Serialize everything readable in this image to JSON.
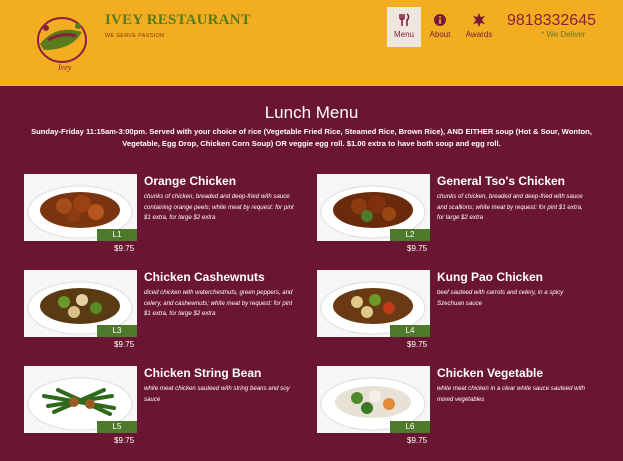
{
  "header": {
    "brand": "IVEY RESTAURANT",
    "tagline": "WE SERVE PASSION",
    "logo_text": "Ivey",
    "phone": "9818332645",
    "deliver": "* We Deliver",
    "nav": [
      {
        "label": "Menu",
        "icon": "restaurant-icon",
        "active": true
      },
      {
        "label": "About",
        "icon": "info-icon",
        "active": false
      },
      {
        "label": "Awards",
        "icon": "award-icon",
        "active": false
      }
    ]
  },
  "main": {
    "title": "Lunch Menu",
    "description": "Sunday-Friday 11:15am-3:00pm. Served with your choice of rice (Vegetable Fried Rice, Steamed Rice, Brown Rice), AND EITHER soup (Hot & Sour, Wonton, Vegetable, Egg Drop, Chicken Corn Soup) OR veggie egg roll. $1.00 extra to have both soup and egg roll.",
    "items": [
      {
        "name": "Orange Chicken",
        "desc": "chunks of chicken, breaded and deep-fried with sauce containing orange peels; white meat by request: for pint $1 extra, for large $2 extra",
        "code": "L1",
        "price": "$9.75"
      },
      {
        "name": "General Tso's Chicken",
        "desc": "chunks of chicken, breaded and deep-fried with sauce and scallions; white meat by request: for pint $1 extra, for large $2 extra",
        "code": "L2",
        "price": "$9.75"
      },
      {
        "name": "Chicken Cashewnuts",
        "desc": "diced chicken with waterchestnuts, green peppers, and celery, and cashewnuts; white meat by request: for pint $1 extra, for large $2 extra",
        "code": "L3",
        "price": "$9.75"
      },
      {
        "name": "Kung Pao Chicken",
        "desc": "beef sauteed with carrots and celery, in a spicy Szechuan sauce",
        "code": "L4",
        "price": "$9.75"
      },
      {
        "name": "Chicken String Bean",
        "desc": "white meat chicken sauteed with string beans and soy sauce",
        "code": "L5",
        "price": "$9.75"
      },
      {
        "name": "Chicken Vegetable",
        "desc": "white meat chicken in a clear white sauce sauteed with mixed vegetables",
        "code": "L6",
        "price": "$9.75"
      }
    ]
  },
  "colors": {
    "header": "#f2ae20",
    "background": "#6b1535",
    "badge": "#4d7a2a",
    "phone": "#8a1f3e"
  }
}
